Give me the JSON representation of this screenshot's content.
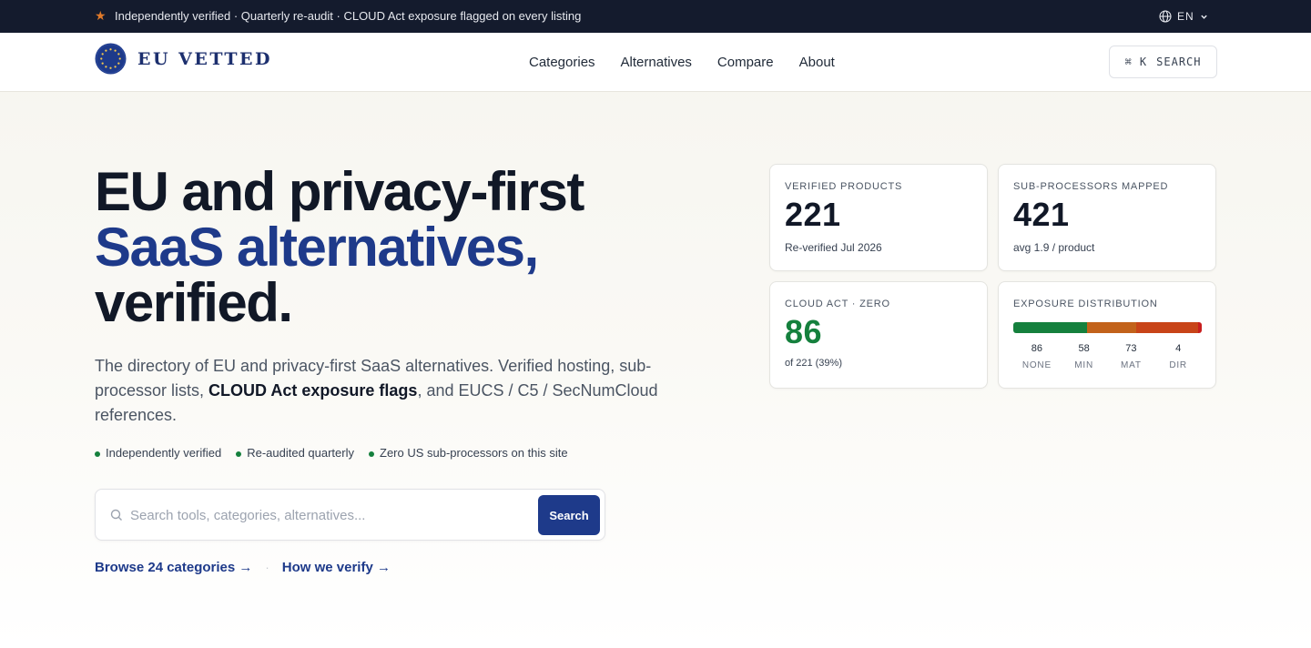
{
  "announcement": {
    "icon": "star-icon",
    "text": "Independently verified · Quarterly re-audit · CLOUD Act exposure flagged on every listing"
  },
  "language": {
    "code": "EN"
  },
  "brand": {
    "name": "EU VETTED"
  },
  "nav": [
    {
      "label": "Categories"
    },
    {
      "label": "Alternatives"
    },
    {
      "label": "Compare"
    },
    {
      "label": "About"
    }
  ],
  "header_search": {
    "shortcut": "⌘ K",
    "label": "SEARCH"
  },
  "hero": {
    "title_line1": "EU and privacy-first",
    "title_line2": "SaaS alternatives,",
    "title_line3": "verified.",
    "lead_before": "The directory of EU and privacy-first SaaS alternatives. Verified hosting, sub-processor lists, ",
    "lead_bold": "CLOUD Act exposure flags",
    "lead_after": ", and EUCS / C5 / SecNumCloud references.",
    "checks": [
      "Independently verified",
      "Re-audited quarterly",
      "Zero US sub-processors on this site"
    ]
  },
  "search": {
    "placeholder": "Search tools, categories, alternatives...",
    "value": "",
    "button_label": "Search"
  },
  "links": {
    "browse": "Browse 24 categories →",
    "separator": "·",
    "verify": "How we verify →"
  },
  "stats": {
    "verified": {
      "label": "VERIFIED PRODUCTS",
      "value": "221",
      "sub": "Re-verified Jul 2026"
    },
    "subprocessors": {
      "label": "SUB-PROCESSORS MAPPED",
      "value": "421",
      "sub": "avg 1.9 / product"
    },
    "cloud_act": {
      "label": "CLOUD ACT · ZERO",
      "value": "86",
      "sub": "of 221 (39%)"
    },
    "exposure": {
      "label": "EXPOSURE DISTRIBUTION",
      "buckets": [
        {
          "key": "NONE",
          "count": "86",
          "color": "#15803d"
        },
        {
          "key": "MIN",
          "count": "58",
          "color": "#c2621a"
        },
        {
          "key": "MAT",
          "count": "73",
          "color": "#c84418"
        },
        {
          "key": "DIR",
          "count": "4",
          "color": "#c81e1e"
        }
      ]
    }
  },
  "colors": {
    "accent": "#1e3a8a",
    "topbar": "#141b2d",
    "positive": "#15803d"
  }
}
